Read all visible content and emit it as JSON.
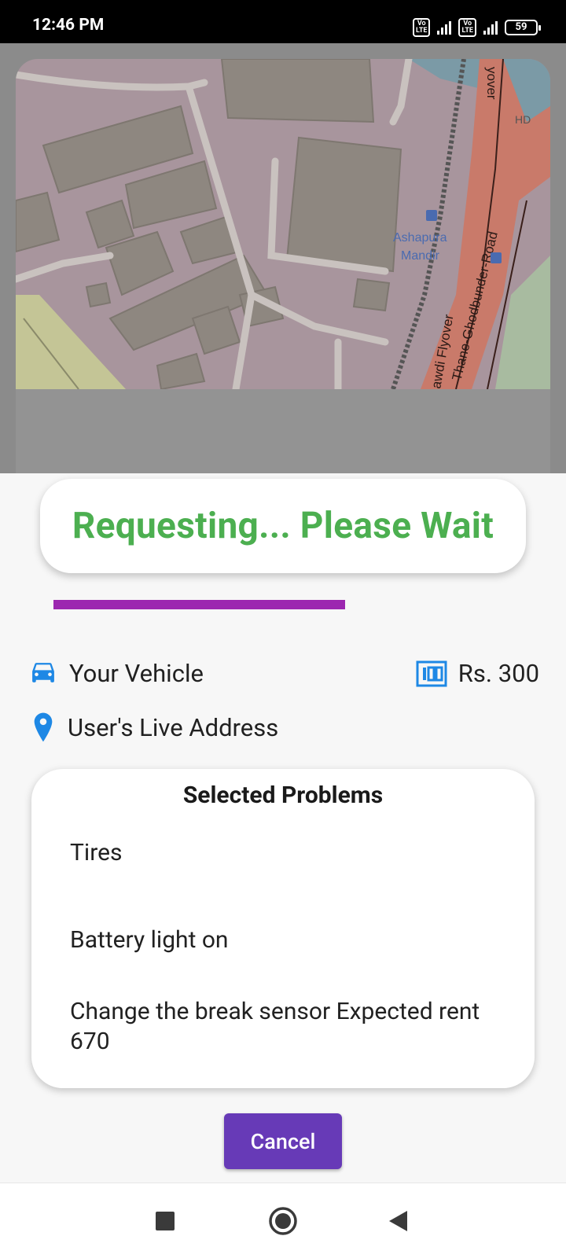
{
  "status_bar": {
    "time": "12:46 PM",
    "sim1": "Vo LTE",
    "sim2": "Vo LTE",
    "battery": "59"
  },
  "map": {
    "labels": [
      "Ashapura",
      "Mandir",
      "Thane-Ghodbunder-Road",
      "awdi Flyover",
      "yover",
      "HD"
    ]
  },
  "request": {
    "status_text": "Requesting... Please Wait",
    "progress_fraction": 0.64,
    "progress_color": "#9c27b0",
    "text_color": "#4caf50"
  },
  "details": {
    "vehicle_icon": "car-icon",
    "vehicle_label": "Your Vehicle",
    "price_icon": "counter-icon",
    "price_label": "Rs. 300",
    "address_icon": "location-pin-icon",
    "address_label": "User's Live Address"
  },
  "problems": {
    "title": "Selected Problems",
    "items": [
      "Tires",
      "Battery light on",
      "Change the break sensor   Expected rent 670"
    ]
  },
  "actions": {
    "cancel_label": "Cancel",
    "cancel_color": "#673ab7"
  },
  "nav": {
    "recents": "recents-square-icon",
    "home": "home-circle-icon",
    "back": "back-triangle-icon"
  }
}
